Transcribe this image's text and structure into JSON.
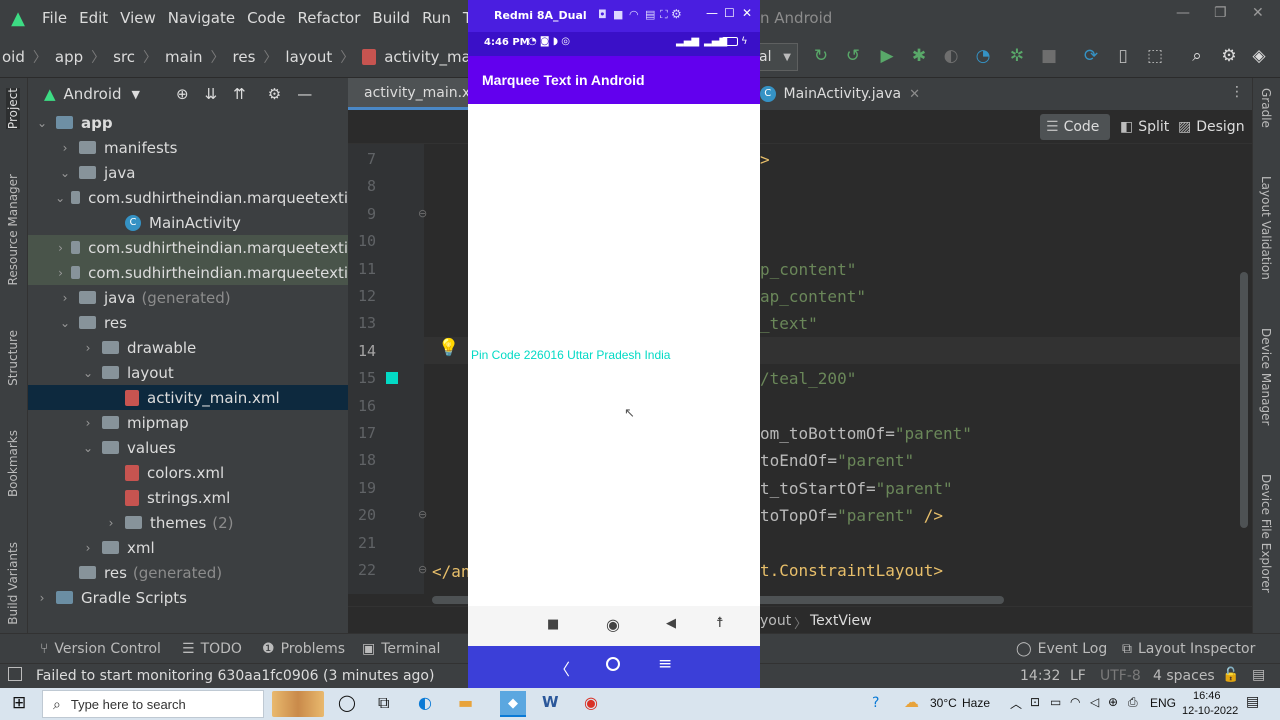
{
  "menu": [
    "File",
    "Edit",
    "View",
    "Navigate",
    "Code",
    "Refactor",
    "Build",
    "Run",
    "Tool"
  ],
  "window_title_fragment": "n Android",
  "breadcrumb": [
    "oid",
    "app",
    "src",
    "main",
    "res",
    "layout",
    "activity_main.xml"
  ],
  "run_config_fragment": "al",
  "project_panel": {
    "view_mode": "Android",
    "tree": [
      {
        "label": "app",
        "level": 0,
        "type": "module",
        "expanded": true
      },
      {
        "label": "manifests",
        "level": 1,
        "type": "folder",
        "expanded": false
      },
      {
        "label": "java",
        "level": 1,
        "type": "folder",
        "expanded": true
      },
      {
        "label": "com.sudhirtheindian.marqueetexti",
        "level": 2,
        "type": "package",
        "expanded": true
      },
      {
        "label": "MainActivity",
        "level": 3,
        "type": "class"
      },
      {
        "label": "com.sudhirtheindian.marqueetexti",
        "level": 2,
        "type": "package",
        "expanded": false,
        "highlight": true
      },
      {
        "label": "com.sudhirtheindian.marqueetexti",
        "level": 2,
        "type": "package",
        "expanded": false,
        "highlight": true
      },
      {
        "label": "java",
        "suffix": "(generated)",
        "level": 1,
        "type": "folder",
        "expanded": false
      },
      {
        "label": "res",
        "level": 1,
        "type": "folder",
        "expanded": true
      },
      {
        "label": "drawable",
        "level": 2,
        "type": "folder",
        "expanded": false
      },
      {
        "label": "layout",
        "level": 2,
        "type": "folder",
        "expanded": true
      },
      {
        "label": "activity_main.xml",
        "level": 3,
        "type": "xml",
        "selected": true
      },
      {
        "label": "mipmap",
        "level": 2,
        "type": "folder",
        "expanded": false
      },
      {
        "label": "values",
        "level": 2,
        "type": "folder",
        "expanded": true
      },
      {
        "label": "colors.xml",
        "level": 3,
        "type": "xml"
      },
      {
        "label": "strings.xml",
        "level": 3,
        "type": "xml"
      },
      {
        "label": "themes",
        "suffix": "(2)",
        "level": 3,
        "type": "folder",
        "expanded": false
      },
      {
        "label": "xml",
        "level": 2,
        "type": "folder",
        "expanded": false
      },
      {
        "label": "res",
        "suffix": "(generated)",
        "level": 1,
        "type": "folder"
      },
      {
        "label": "Gradle Scripts",
        "level": 0,
        "type": "gradle",
        "expanded": false
      }
    ]
  },
  "left_tool_tabs": [
    "Project",
    "Resource Manager",
    "Structure",
    "Bookmarks",
    "Build Variants"
  ],
  "right_tool_tabs": [
    "Gradle",
    "Layout Validation",
    "Device Manager",
    "Device File Explorer"
  ],
  "editor": {
    "tabs": [
      {
        "label": "activity_main.x",
        "active": true
      },
      {
        "label": "MainActivity.java",
        "active": false
      }
    ],
    "view_modes": [
      "Code",
      "Split",
      "Design"
    ],
    "active_view_mode": "Code",
    "inspection_count": "1",
    "line_numbers": [
      "7",
      "8",
      "9",
      "10",
      "11",
      "12",
      "13",
      "14",
      "15",
      "16",
      "17",
      "18",
      "19",
      "20",
      "21",
      "22"
    ],
    "code_fragments": [
      {
        "line": "7",
        "parts": [
          {
            "t": ">",
            "c": "tag"
          }
        ]
      },
      {
        "line": "11",
        "parts": [
          {
            "t": "p_content\"",
            "c": "str"
          }
        ]
      },
      {
        "line": "12",
        "parts": [
          {
            "t": "ap_content\"",
            "c": "str"
          }
        ]
      },
      {
        "line": "13",
        "parts": [
          {
            "t": "_text\"",
            "c": "str"
          }
        ]
      },
      {
        "line": "15",
        "parts": [
          {
            "t": "/teal_200\"",
            "c": "str"
          }
        ]
      },
      {
        "line": "17",
        "parts": [
          {
            "t": "om_toBottomOf=",
            "c": "attr"
          },
          {
            "t": "\"parent\"",
            "c": "str"
          }
        ]
      },
      {
        "line": "18",
        "parts": [
          {
            "t": "toEndOf=",
            "c": "attr"
          },
          {
            "t": "\"parent\"",
            "c": "str"
          }
        ]
      },
      {
        "line": "19",
        "parts": [
          {
            "t": "t_toStartOf=",
            "c": "attr"
          },
          {
            "t": "\"parent\"",
            "c": "str"
          }
        ]
      },
      {
        "line": "20",
        "parts": [
          {
            "t": "toTopOf=",
            "c": "attr"
          },
          {
            "t": "\"parent\"",
            "c": "str"
          },
          {
            "t": " />",
            "c": "tag"
          }
        ]
      },
      {
        "line": "22",
        "parts": [
          {
            "t": "t.ConstraintLayout>",
            "c": "tag"
          }
        ]
      }
    ],
    "closing_tag_start": "</an",
    "breadcrumb_bottom": [
      "yout",
      "TextView"
    ]
  },
  "bottom_tabs": [
    "Version Control",
    "TODO",
    "Problems",
    "Terminal",
    "Event Log",
    "Layout Inspector"
  ],
  "status": {
    "message": "Failed to start monitoring 630aa1fc0906 (3 minutes ago)",
    "position": "14:32",
    "line_sep": "LF",
    "encoding": "UTF-8",
    "indent": "4 spaces"
  },
  "phone": {
    "device_name": "Redmi 8A_Dual",
    "status_time": "4:46 PM",
    "app_title": "Marquee Text in Android",
    "marquee_text": "Pin Code 226016 Uttar Pradesh India",
    "marquee_color": "#03dac5"
  },
  "taskbar": {
    "search_placeholder": "Type here to search",
    "weather_temp": "30°C",
    "weather_desc": "Haze",
    "lang": "ENG",
    "time": "16:46",
    "date": "12-10-2022"
  },
  "colors": {
    "ide_bg": "#2b2b2b",
    "panel_bg": "#3c3f41",
    "app_bar": "#6200ee",
    "selection": "#0d293e",
    "string": "#6a8759",
    "tag": "#e8bf6a"
  }
}
